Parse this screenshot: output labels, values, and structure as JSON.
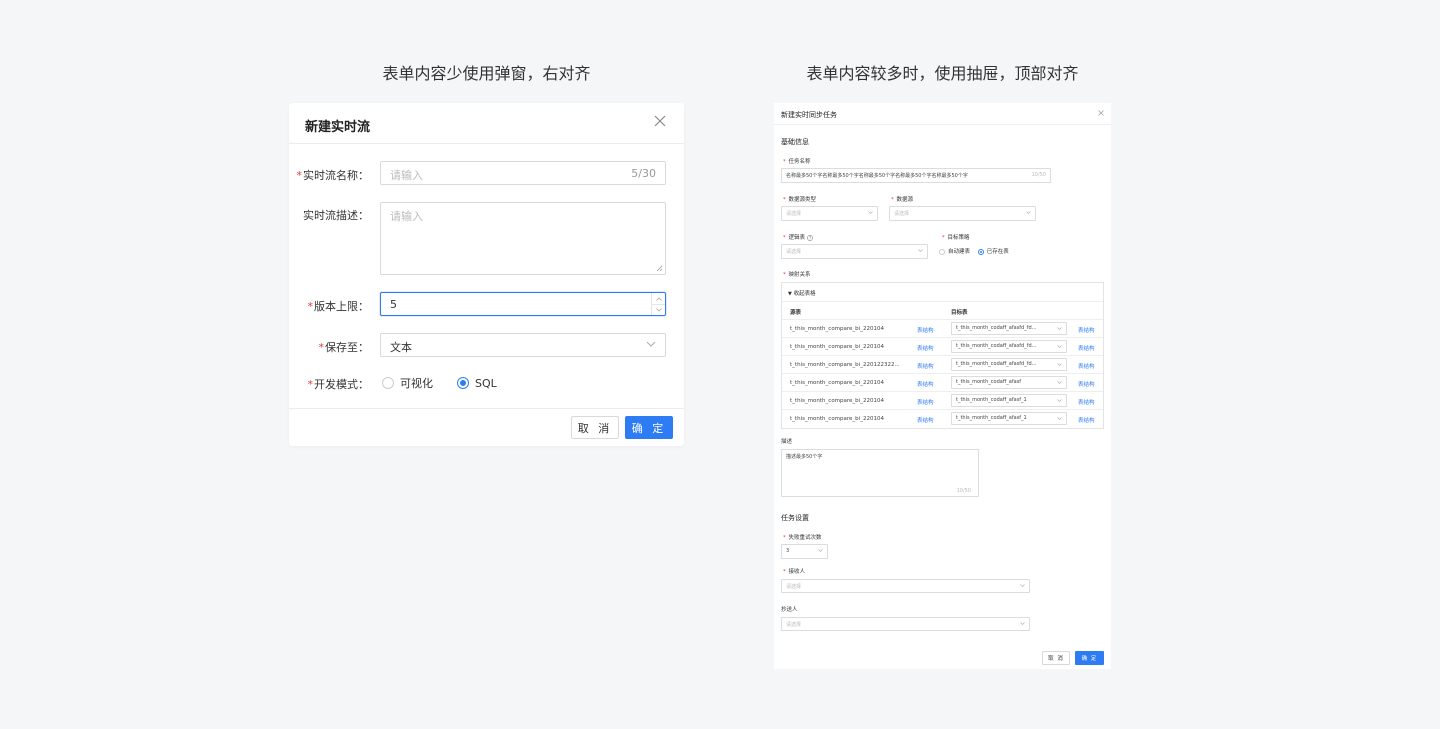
{
  "captions": {
    "left": "表单内容少使用弹窗，右对齐",
    "right": "表单内容较多时，使用抽屉，顶部对齐"
  },
  "modal": {
    "title": "新建实时流",
    "fields": {
      "name": {
        "label": "实时流名称：",
        "placeholder": "请输入",
        "count": "5/30",
        "required": true
      },
      "desc": {
        "label": "实时流描述：",
        "placeholder": "请输入",
        "required": false
      },
      "version": {
        "label": "版本上限：",
        "value": "5",
        "required": true
      },
      "save_to": {
        "label": "保存至：",
        "value": "文本",
        "required": true
      },
      "mode": {
        "label": "开发模式：",
        "options": [
          "可视化",
          "SQL"
        ],
        "selected": "SQL",
        "required": true
      }
    },
    "cancel_label": "取 消",
    "ok_label": "确 定"
  },
  "drawer": {
    "title": "新建实时同步任务",
    "basic_section": "基础信息",
    "task_name": {
      "label": "任务名称",
      "value": "名称最多50个字名称最多50个字名称最多50个字名称最多50个字名称最多50个字",
      "count": "10/50"
    },
    "datasource_type": {
      "label": "数据源类型",
      "placeholder": "请选择"
    },
    "datasource": {
      "label": "数据源",
      "placeholder": "请选择"
    },
    "logic_table": {
      "label": "逻辑表",
      "placeholder": "请选择"
    },
    "target_strategy": {
      "label": "目标策略",
      "options": [
        "自动建表",
        "已存在表"
      ],
      "selected": "已存在表"
    },
    "mapping": {
      "label": "映射关系",
      "collapse_label": "收起表格",
      "col_source": "源表",
      "col_target": "目标表",
      "rows": [
        {
          "source": "t_this_month_compare_bi_220104",
          "source_link": "表结构",
          "target": "t_this_month_codaff_afasfd_fd...",
          "target_link": "表结构"
        },
        {
          "source": "t_this_month_compare_bi_220104",
          "source_link": "表结构",
          "target": "t_this_month_codaff_afasfd_fd...",
          "target_link": "表结构"
        },
        {
          "source": "t_this_month_compare_bi_220122322...",
          "source_link": "表结构",
          "target": "t_this_month_codaff_afasfd_fd...",
          "target_link": "表结构"
        },
        {
          "source": "t_this_month_compare_bi_220104",
          "source_link": "表结构",
          "target": "t_this_month_codaff_afasf",
          "target_link": "表结构"
        },
        {
          "source": "t_this_month_compare_bi_220104",
          "source_link": "表结构",
          "target": "t_this_month_codaff_afasf_1",
          "target_link": "表结构"
        },
        {
          "source": "t_this_month_compare_bi_220104",
          "source_link": "表结构",
          "target": "t_this_month_codaff_afasf_1",
          "target_link": "表结构"
        }
      ]
    },
    "description": {
      "label": "描述",
      "value": "描述最多50个字",
      "count": "10/50"
    },
    "task_section": "任务设置",
    "retry": {
      "label": "失败重试次数",
      "value": "3"
    },
    "receiver": {
      "label": "接收人",
      "placeholder": "请选择"
    },
    "cc": {
      "label": "抄送人",
      "placeholder": "请选择"
    },
    "cancel_label": "取 消",
    "ok_label": "确 定"
  },
  "colors": {
    "primary": "#2d7cf4",
    "required": "#e03b3b",
    "background": "#f5f6f8"
  }
}
